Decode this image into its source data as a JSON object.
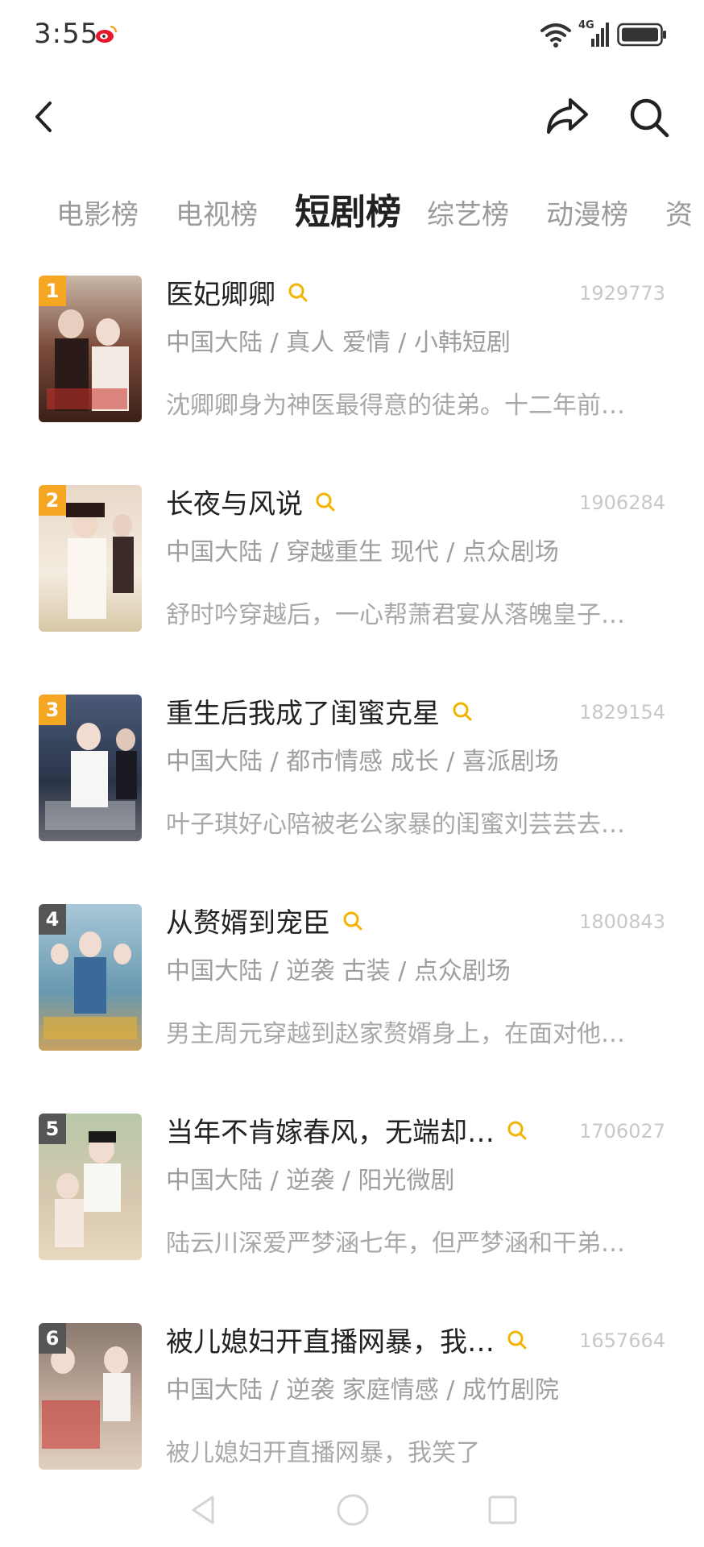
{
  "status_bar": {
    "time": "3:55",
    "network": "4G"
  },
  "tabs": [
    {
      "label": "电影榜"
    },
    {
      "label": "电视榜"
    },
    {
      "label": "短剧榜",
      "active": true
    },
    {
      "label": "综艺榜"
    },
    {
      "label": "动漫榜"
    },
    {
      "label": "资"
    }
  ],
  "items": [
    {
      "rank": "1",
      "title": "医妃卿卿",
      "count": "1929773",
      "meta": "中国大陆 / 真人 爱情 / 小韩短剧",
      "desc": "沈卿卿身为神医最得意的徒弟。十二年前…",
      "badge_color": "#f5a623"
    },
    {
      "rank": "2",
      "title": "长夜与风说",
      "count": "1906284",
      "meta": "中国大陆 / 穿越重生 现代 / 点众剧场",
      "desc": "舒时吟穿越后，一心帮萧君宴从落魄皇子…",
      "badge_color": "#f5a623"
    },
    {
      "rank": "3",
      "title": "重生后我成了闺蜜克星",
      "count": "1829154",
      "meta": "中国大陆 / 都市情感 成长 / 喜派剧场",
      "desc": "叶子琪好心陪被老公家暴的闺蜜刘芸芸去…",
      "badge_color": "#f5a623"
    },
    {
      "rank": "4",
      "title": "从赘婿到宠臣",
      "count": "1800843",
      "meta": "中国大陆 / 逆袭 古装 / 点众剧场",
      "desc": "男主周元穿越到赵家赘婿身上，在面对他…",
      "badge_color": "#555555"
    },
    {
      "rank": "5",
      "title": "当年不肯嫁春风，无端却…",
      "count": "1706027",
      "meta": "中国大陆 / 逆袭 / 阳光微剧",
      "desc": "陆云川深爱严梦涵七年，但严梦涵和干弟…",
      "badge_color": "#555555"
    },
    {
      "rank": "6",
      "title": "被儿媳妇开直播网暴，我…",
      "count": "1657664",
      "meta": "中国大陆 / 逆袭 家庭情感 / 成竹剧院",
      "desc": "被儿媳妇开直播网暴，我笑了",
      "badge_color": "#555555"
    }
  ],
  "colors": {
    "accent": "#f5b301",
    "title": "#222222",
    "muted": "#9e9e9e"
  },
  "icons": {
    "back": "chevron-left-icon",
    "share": "share-icon",
    "search": "search-icon"
  }
}
